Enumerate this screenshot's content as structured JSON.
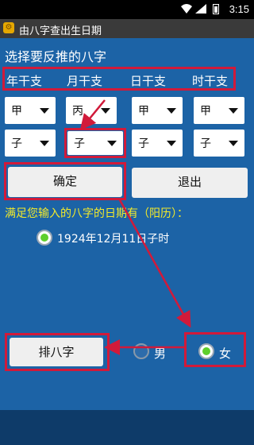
{
  "status": {
    "time": "3:15"
  },
  "app": {
    "title": "由八字查出生日期"
  },
  "heading": "选择要反推的八字",
  "pillars": {
    "year": "年干支",
    "month": "月干支",
    "day": "日干支",
    "hour": "时干支"
  },
  "spinners": {
    "stems": [
      "甲",
      "丙",
      "甲",
      "甲"
    ],
    "branches": [
      "子",
      "子",
      "子",
      "子"
    ]
  },
  "buttons": {
    "confirm": "确定",
    "exit": "退出",
    "paibazi": "排八字"
  },
  "result_hint": "满足您输入的八字的日期有（阳历）：",
  "result_option": "1924年12月11日子时",
  "gender": {
    "male": "男",
    "female": "女",
    "selected": "female"
  },
  "annotation_color": "#d11a3a"
}
